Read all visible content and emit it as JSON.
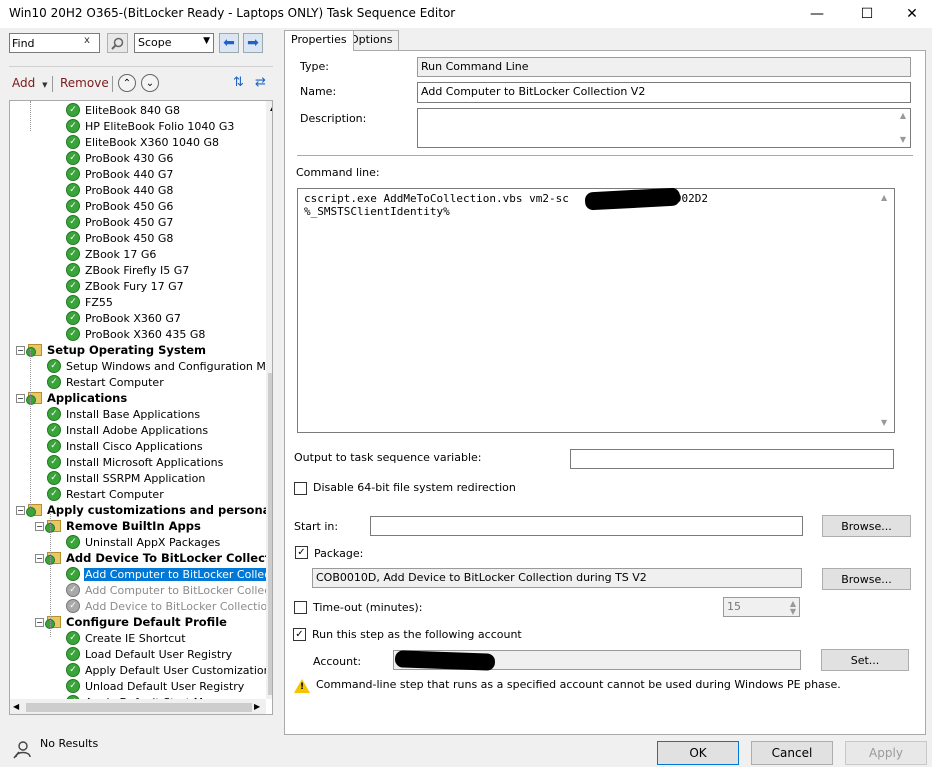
{
  "window": {
    "title": "Win10 20H2 O365-(BitLocker Ready - Laptops ONLY) Task Sequence Editor",
    "minimize": "—",
    "maximize": "☐",
    "close": "✕"
  },
  "toolbar": {
    "find_value": "Find",
    "find_clear": "x",
    "scope_value": "Scope",
    "add_label": "Add",
    "remove_label": "Remove"
  },
  "tree": {
    "items": [
      {
        "label": "EliteBook 840 G8",
        "kind": "step",
        "indent": 3
      },
      {
        "label": "HP EliteBook Folio 1040 G3",
        "kind": "step",
        "indent": 3
      },
      {
        "label": "EliteBook X360 1040 G8",
        "kind": "step",
        "indent": 3
      },
      {
        "label": "ProBook 430 G6",
        "kind": "step",
        "indent": 3
      },
      {
        "label": "ProBook 440 G7",
        "kind": "step",
        "indent": 3
      },
      {
        "label": "ProBook 440 G8",
        "kind": "step",
        "indent": 3
      },
      {
        "label": "ProBook 450 G6",
        "kind": "step",
        "indent": 3
      },
      {
        "label": "ProBook 450 G7",
        "kind": "step",
        "indent": 3
      },
      {
        "label": "ProBook 450 G8",
        "kind": "step",
        "indent": 3
      },
      {
        "label": "ZBook 17 G6",
        "kind": "step",
        "indent": 3
      },
      {
        "label": "ZBook Firefly I5 G7",
        "kind": "step",
        "indent": 3
      },
      {
        "label": "ZBook Fury 17 G7",
        "kind": "step",
        "indent": 3
      },
      {
        "label": "FZ55",
        "kind": "step",
        "indent": 3
      },
      {
        "label": "ProBook X360 G7",
        "kind": "step",
        "indent": 3
      },
      {
        "label": "ProBook X360 435 G8",
        "kind": "step",
        "indent": 3
      },
      {
        "label": "Setup Operating System",
        "kind": "group",
        "indent": 0
      },
      {
        "label": "Setup Windows and Configuration Mana",
        "kind": "step",
        "indent": 1
      },
      {
        "label": "Restart Computer",
        "kind": "step",
        "indent": 1
      },
      {
        "label": "Applications",
        "kind": "group",
        "indent": 0
      },
      {
        "label": "Install Base Applications",
        "kind": "step",
        "indent": 1
      },
      {
        "label": "Install Adobe Applications",
        "kind": "step",
        "indent": 1
      },
      {
        "label": "Install Cisco Applications",
        "kind": "step",
        "indent": 1
      },
      {
        "label": "Install Microsoft Applications",
        "kind": "step",
        "indent": 1
      },
      {
        "label": "Install SSRPM Application",
        "kind": "step",
        "indent": 1
      },
      {
        "label": "Restart Computer",
        "kind": "step",
        "indent": 1
      },
      {
        "label": "Apply customizations and personaliz",
        "kind": "group",
        "indent": 0
      },
      {
        "label": "Remove BuiltIn Apps",
        "kind": "group",
        "indent": 1
      },
      {
        "label": "Uninstall AppX Packages",
        "kind": "step",
        "indent": 2
      },
      {
        "label": "Add Device To BitLocker Collect",
        "kind": "group",
        "indent": 1
      },
      {
        "label": "Add Computer to BitLocker Collectio",
        "kind": "step",
        "indent": 2,
        "selected": true
      },
      {
        "label": "Add Computer to BitLocker Collecti",
        "kind": "disabled",
        "indent": 2
      },
      {
        "label": "Add Device to BitLocker Collection",
        "kind": "disabled",
        "indent": 2
      },
      {
        "label": "Configure Default Profile",
        "kind": "group",
        "indent": 1
      },
      {
        "label": "Create IE Shortcut",
        "kind": "step",
        "indent": 2
      },
      {
        "label": "Load Default User Registry",
        "kind": "step",
        "indent": 2
      },
      {
        "label": "Apply Default User Customizations",
        "kind": "step",
        "indent": 2
      },
      {
        "label": "Unload Default User Registry",
        "kind": "step",
        "indent": 2
      },
      {
        "label": "Apply Default Start Menu",
        "kind": "step",
        "indent": 2
      }
    ]
  },
  "status": {
    "text": "No Results"
  },
  "tabs": {
    "properties": "Properties",
    "options": "Options"
  },
  "props": {
    "type_label": "Type:",
    "type_value": "Run Command Line",
    "name_label": "Name:",
    "name_value": "Add Computer to BitLocker Collection V2",
    "description_label": "Description:",
    "command_label": "Command line:",
    "command_value": "cscript.exe AddMeToCollection.vbs vm2-sc             COB002D2\n%_SMSTSClientIdentity%",
    "output_label": "Output to task sequence variable:",
    "disable64_label": "Disable 64-bit file system redirection",
    "start_in_label": "Start in:",
    "browse_label": "Browse...",
    "package_label": "Package:",
    "package_value": "COB0010D, Add Device to BitLocker Collection during TS V2",
    "timeout_label": "Time-out (minutes):",
    "timeout_value": "15",
    "run_as_label": "Run this step as the following account",
    "account_label": "Account:",
    "set_label": "Set...",
    "warning_text": "Command-line step that runs as a specified account cannot be used during Windows PE phase."
  },
  "buttons": {
    "ok": "OK",
    "cancel": "Cancel",
    "apply": "Apply"
  }
}
